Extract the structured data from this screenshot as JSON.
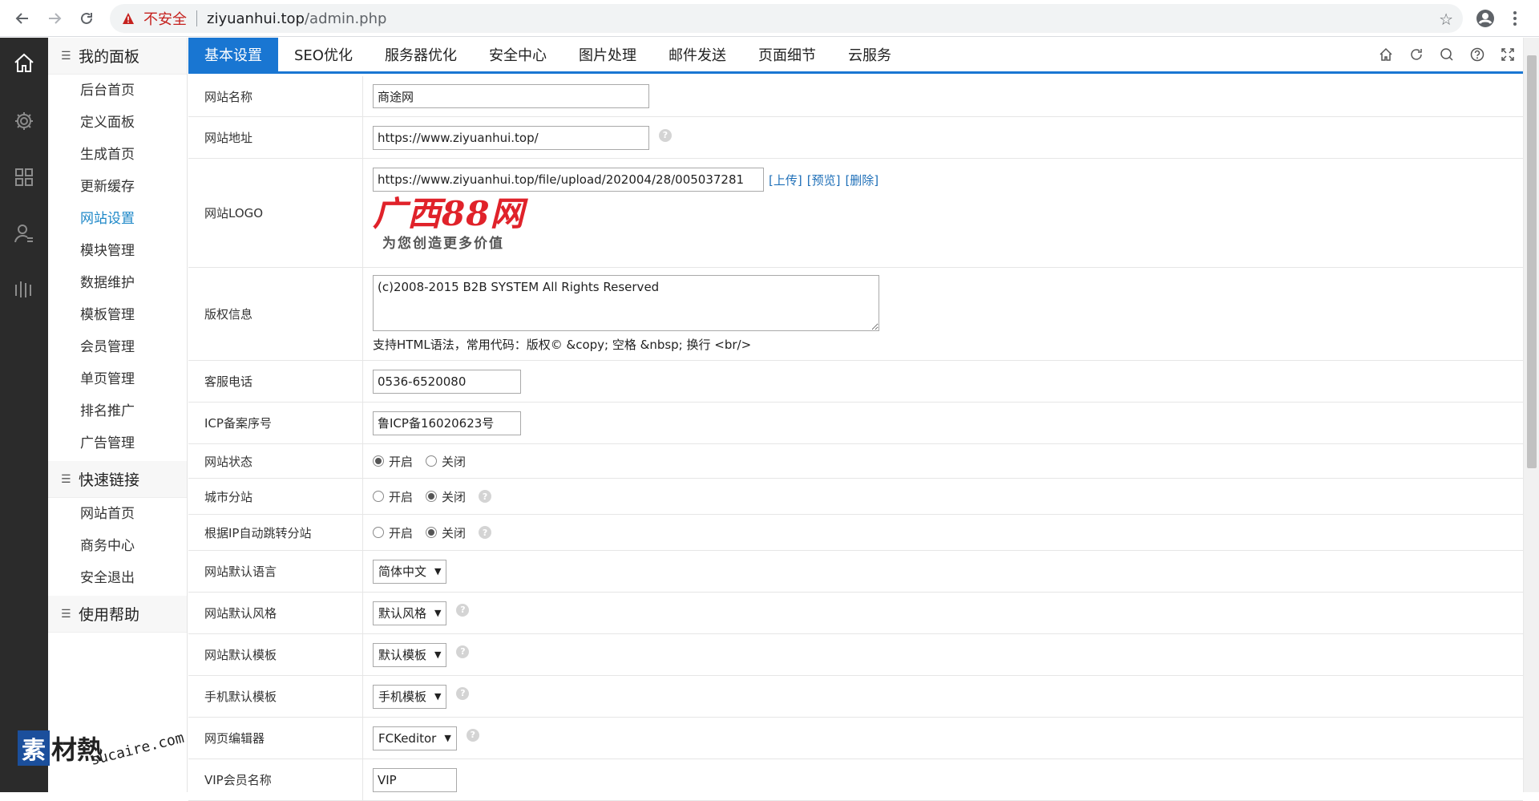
{
  "browser": {
    "back_icon": "arrow-left-icon",
    "forward_icon": "arrow-right-icon",
    "reload_icon": "reload-icon",
    "security_label": "不安全",
    "url_host": "ziyuanhui.top",
    "url_path": "/admin.php",
    "bookmark_icon": "star-icon"
  },
  "rail": {
    "icons": [
      "home-icon",
      "gear-icon",
      "grid-icon",
      "user-icon",
      "bars-icon"
    ]
  },
  "sidebar": {
    "groups": [
      {
        "title": "我的面板",
        "items": [
          "后台首页",
          "定义面板",
          "生成首页",
          "更新缓存",
          "网站设置",
          "模块管理",
          "数据维护",
          "模板管理",
          "会员管理",
          "单页管理",
          "排名推广",
          "广告管理"
        ],
        "active_item": "网站设置"
      },
      {
        "title": "快速链接",
        "items": [
          "网站首页",
          "商务中心",
          "安全退出"
        ]
      },
      {
        "title": "使用帮助",
        "items": []
      }
    ]
  },
  "tabs": {
    "items": [
      "基本设置",
      "SEO优化",
      "服务器优化",
      "安全中心",
      "图片处理",
      "邮件发送",
      "页面细节",
      "云服务"
    ],
    "active": "基本设置",
    "tools": [
      "home-icon",
      "refresh-icon",
      "search-icon",
      "help-icon",
      "fullscreen-icon"
    ]
  },
  "form": {
    "site_name": {
      "label": "网站名称",
      "value": "商途网"
    },
    "site_url": {
      "label": "网站地址",
      "value": "https://www.ziyuanhui.top/"
    },
    "logo": {
      "label": "网站LOGO",
      "value": "https://www.ziyuanhui.top/file/upload/202004/28/005037281",
      "upload": "[上传]",
      "preview": "[预览]",
      "delete": "[删除]",
      "image_text": "广西88网",
      "image_subtext": "为您创造更多价值"
    },
    "copyright": {
      "label": "版权信息",
      "value": "(c)2008-2015 B2B SYSTEM All Rights Reserved",
      "note": "支持HTML语法，常用代码：版权© &copy; 空格 &nbsp; 换行 <br/>"
    },
    "phone": {
      "label": "客服电话",
      "value": "0536-6520080"
    },
    "icp": {
      "label": "ICP备案序号",
      "value": "鲁ICP备16020623号"
    },
    "site_status": {
      "label": "网站状态",
      "on": "开启",
      "off": "关闭",
      "selected": "on"
    },
    "city_sub": {
      "label": "城市分站",
      "on": "开启",
      "off": "关闭",
      "selected": "off"
    },
    "ip_jump": {
      "label": "根据IP自动跳转分站",
      "on": "开启",
      "off": "关闭",
      "selected": "off"
    },
    "language": {
      "label": "网站默认语言",
      "value": "简体中文"
    },
    "style": {
      "label": "网站默认风格",
      "value": "默认风格"
    },
    "template": {
      "label": "网站默认模板",
      "value": "默认模板"
    },
    "mobile_template": {
      "label": "手机默认模板",
      "value": "手机模板"
    },
    "editor": {
      "label": "网页编辑器",
      "value": "FCKeditor"
    },
    "vip_name": {
      "label": "VIP会员名称",
      "value": "VIP"
    }
  },
  "watermark": {
    "mark": "素",
    "text": "材熱",
    "url": "sucaire.com"
  }
}
